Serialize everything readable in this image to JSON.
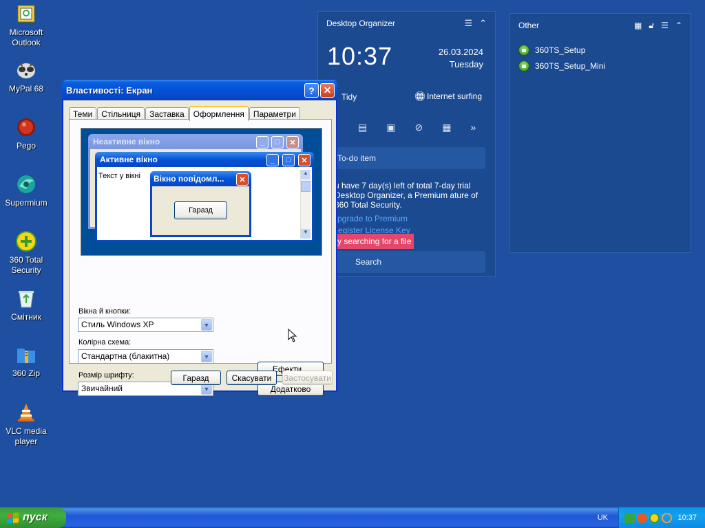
{
  "desktop_icons": [
    {
      "label": "Microsoft Outlook",
      "icon": "outlook-icon"
    },
    {
      "label": "MyPal 68",
      "icon": "mypal-icon"
    },
    {
      "label": "Pego",
      "icon": "pego-icon"
    },
    {
      "label": "Supermium",
      "icon": "supermium-icon"
    },
    {
      "label": "360 Total Security",
      "icon": "360-security-icon"
    },
    {
      "label": "Смітник",
      "icon": "recycle-bin-icon"
    },
    {
      "label": "360 Zip",
      "icon": "360-zip-icon"
    },
    {
      "label": "VLC media player",
      "icon": "vlc-icon"
    }
  ],
  "organizer": {
    "title": "Desktop Organizer",
    "time": "10:37",
    "date": "26.03.2024",
    "weekday": "Tuesday",
    "tidy": "Tidy",
    "internet": "Internet surfing",
    "todo": "To-do item",
    "trial_text": "u have 7 day(s) left of total 7-day trial Desktop Organizer, a Premium ature of 360 Total Security.",
    "upgrade_link": "pgrade to Premium",
    "register_link": "egister License Key",
    "search_hint": "y searching for a file",
    "search_placeholder": "Search"
  },
  "other_panel": {
    "title": "Other",
    "files": [
      "360TS_Setup",
      "360TS_Setup_Mini"
    ]
  },
  "dialog": {
    "title": "Властивості: Екран",
    "tabs": [
      "Теми",
      "Стільниця",
      "Заставка",
      "Оформлення",
      "Параметри"
    ],
    "active_tab": "Оформлення",
    "preview": {
      "inactive_title": "Неактивне вікно",
      "active_title": "Активне вікно",
      "window_text": "Текст у вікні",
      "msgbox_title": "Вікно повідомл...",
      "msgbox_ok": "Гаразд"
    },
    "windows_buttons_label": "Вікна й кнопки:",
    "windows_buttons_value": "Стиль Windows XP",
    "color_scheme_label": "Колірна схема:",
    "color_scheme_value": "Стандартна (блакитна)",
    "font_size_label": "Розмір шрифту:",
    "font_size_value": "Звичайний",
    "effects_button": "Ефекти...",
    "advanced_button": "Додатково",
    "ok_button": "Гаразд",
    "cancel_button": "Скасувати",
    "apply_button": "Застосувати"
  },
  "taskbar": {
    "start_label": "пуск",
    "language": "UK",
    "clock": "10:37"
  },
  "colors": {
    "desktop": "#1e4fa0",
    "xp_title_blue": "#0452d6",
    "close_red": "#c9401f",
    "search_hint_bg": "#e4476b"
  }
}
